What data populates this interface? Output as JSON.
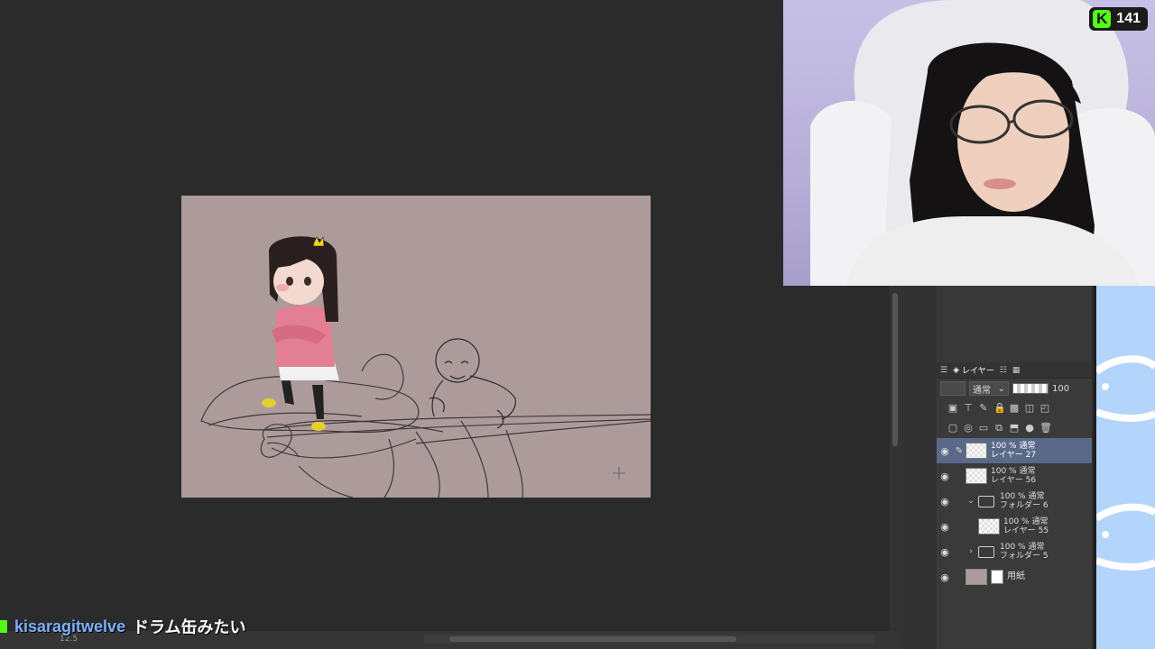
{
  "viewer_count": "141",
  "chat": {
    "username": "kisaragitwelve",
    "message": "ドラム缶みたい"
  },
  "statusbar": {
    "zoom": "12.5"
  },
  "layer_panel": {
    "tab_layer": "レイヤー",
    "blend_mode": "通常",
    "opacity": "100",
    "layers": [
      {
        "mode": "100 % 通常",
        "name": "レイヤー 27",
        "selected": true
      },
      {
        "mode": "100 % 通常",
        "name": "レイヤー 56"
      },
      {
        "mode": "100 % 通常",
        "name": "フォルダー 6",
        "folder": true,
        "expanded": true
      },
      {
        "mode": "100 % 通常",
        "name": "レイヤー 55"
      },
      {
        "mode": "100 % 通常",
        "name": "フォルダー 5",
        "folder": true,
        "expanded": false
      },
      {
        "name": "用紙",
        "paper": true
      }
    ]
  },
  "colors": {
    "canvas": "#ad9b9c",
    "accent_kick": "#53fc18",
    "selected_layer": "#5a6988"
  }
}
